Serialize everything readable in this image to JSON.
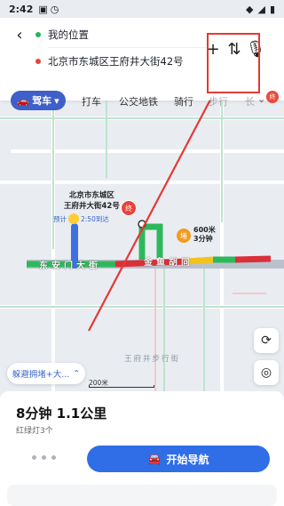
{
  "status_bar": {
    "time": "2:42",
    "icons": [
      "notification-icon",
      "alarm-icon",
      "wifi-icon",
      "signal-icon",
      "battery-icon"
    ]
  },
  "route": {
    "origin": "我的位置",
    "destination": "北京市东城区王府井大街42号"
  },
  "actions": {
    "add": "+",
    "swap": "⇅",
    "voice": "🎙"
  },
  "tabs": {
    "active": "驾车",
    "items": [
      "打车",
      "公交地铁",
      "骑行",
      "步行",
      "长"
    ]
  },
  "tab_badge": "终",
  "map": {
    "destination_label_line1": "北京市东城区",
    "destination_label_line2": "王府井大街42号",
    "eta_prefix": "预计",
    "eta_time": "2:50到达",
    "end_marker": "终",
    "traffic_marker": "堵",
    "traffic_distance": "600米",
    "traffic_duration": "3分钟",
    "road1": "东安门大街",
    "road2": "金鱼胡同",
    "street": "王府井步行街",
    "scale": "200米",
    "avoid_chip": "躲避拥堵+大..."
  },
  "summary": {
    "time_distance": "8分钟  1.1公里",
    "traffic_lights": "红绿灯3个",
    "start_nav": "开始导航"
  },
  "colors": {
    "accent": "#2f6ee6",
    "drive_tab": "#3f5fc9",
    "route_green": "#2eb85c",
    "route_red": "#d9303a",
    "route_yellow": "#f3c31c",
    "highlight": "#e53935"
  }
}
